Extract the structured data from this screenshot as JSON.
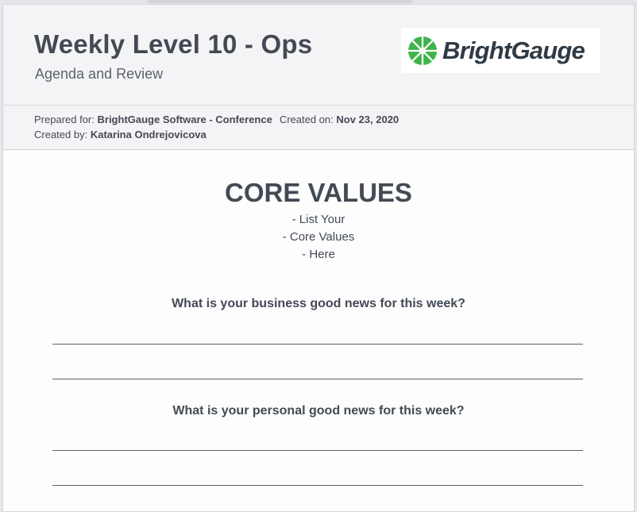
{
  "header": {
    "title": "Weekly Level 10 - Ops",
    "subtitle": "Agenda and Review",
    "logo_text": "BrightGauge",
    "logo_icon": "brightgauge-gauge-icon",
    "brand_color": "#3fb44a"
  },
  "meta": {
    "prepared_for_label": "Prepared for:",
    "prepared_for_value": "BrightGauge Software - Conference",
    "created_on_label": "Created on:",
    "created_on_value": "Nov 23, 2020",
    "created_by_label": "Created by:",
    "created_by_value": "Katarina Ondrejovicova"
  },
  "content": {
    "core_values_title": "CORE VALUES",
    "core_values_items": [
      "- List Your",
      "- Core Values",
      "- Here"
    ],
    "questions": [
      "What is your business good news for this week?",
      "What is your personal good news for this week?"
    ]
  }
}
